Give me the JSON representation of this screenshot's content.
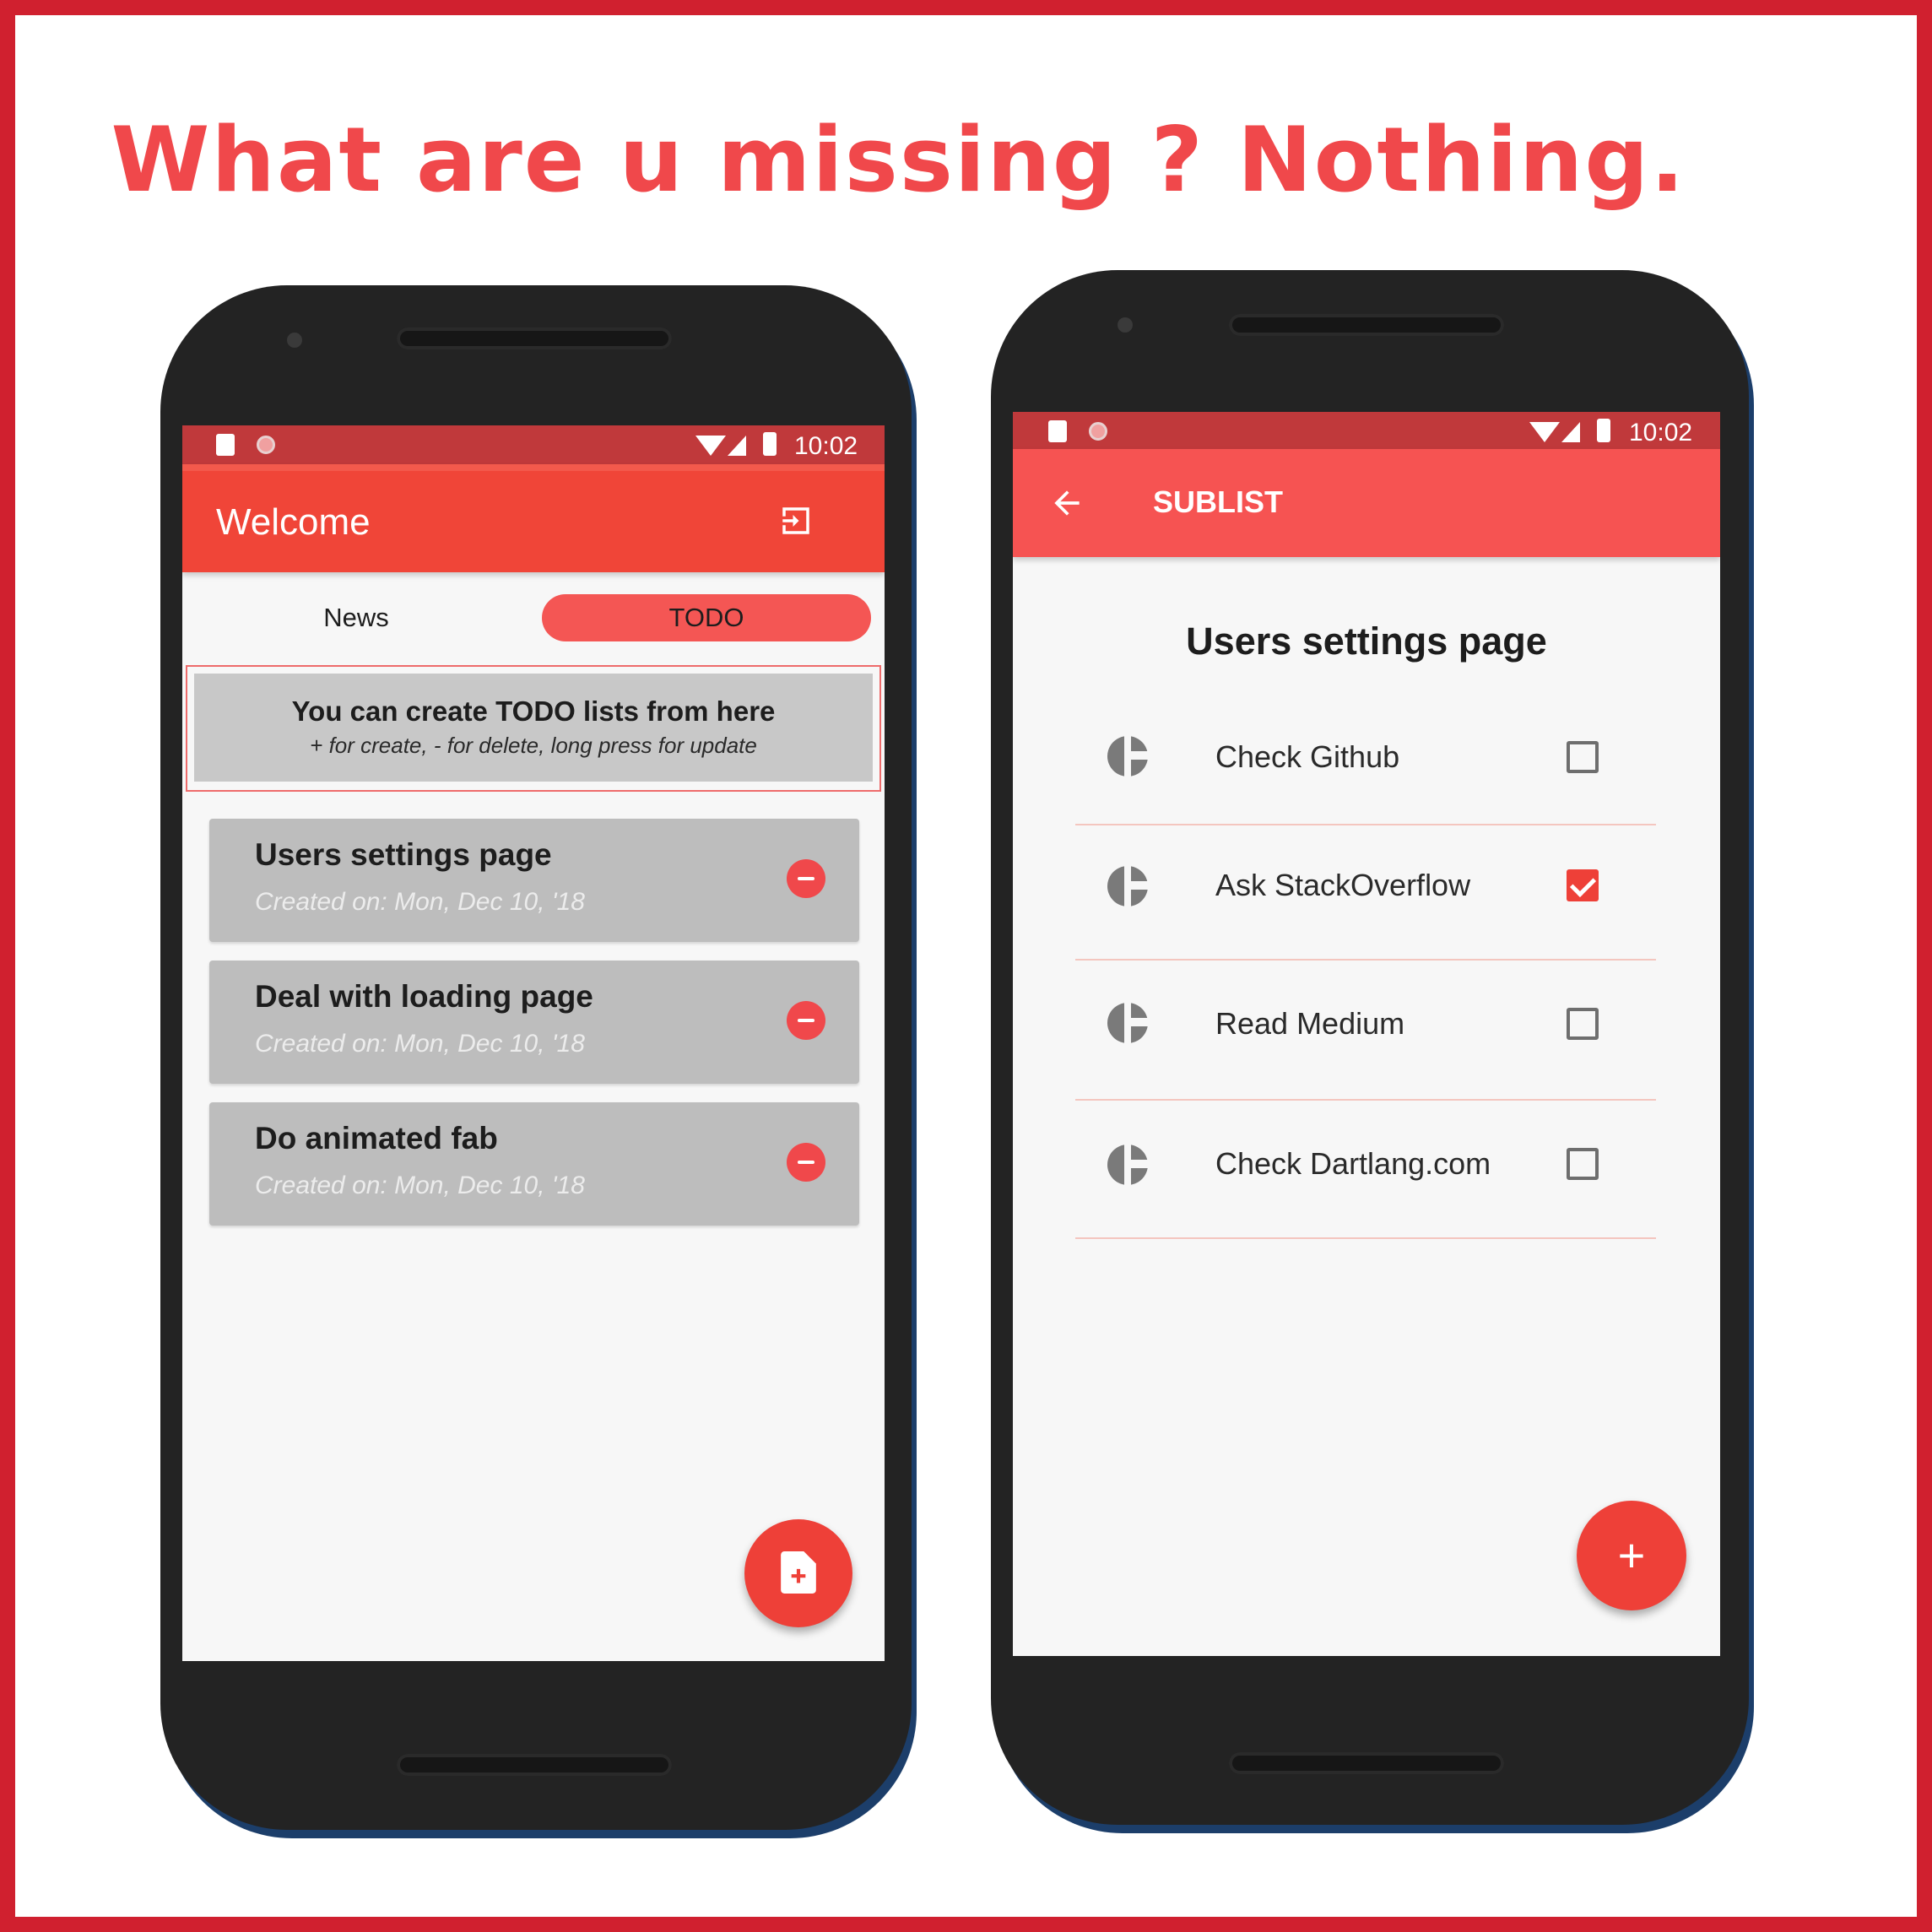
{
  "headline": "What are u missing ? Nothing.",
  "colors": {
    "brand_red": "#f0484b",
    "frame_red": "#d0202f",
    "status_bar": "#c0393b"
  },
  "left_phone": {
    "status_bar": {
      "time": "10:02",
      "icons": [
        "sd-card-icon",
        "circle-notification-icon",
        "wifi-icon",
        "signal-icon",
        "battery-icon"
      ]
    },
    "app_bar": {
      "title": "Welcome",
      "action_icon": "logout-icon"
    },
    "tabs": [
      {
        "label": "News",
        "selected": false
      },
      {
        "label": "TODO",
        "selected": true
      }
    ],
    "info_box": {
      "title": "You can create TODO lists from here",
      "subtitle": "+ for create, - for delete, long press for update"
    },
    "todo_lists": [
      {
        "title": "Users settings page",
        "created": "Created on: Mon, Dec 10, '18"
      },
      {
        "title": "Deal with loading page",
        "created": "Created on: Mon, Dec 10, '18"
      },
      {
        "title": "Do animated fab",
        "created": "Created on: Mon, Dec 10, '18"
      }
    ],
    "fab_icon": "new-document-icon"
  },
  "right_phone": {
    "status_bar": {
      "time": "10:02",
      "icons": [
        "sd-card-icon",
        "circle-notification-icon",
        "wifi-icon",
        "signal-icon",
        "battery-icon"
      ]
    },
    "app_bar": {
      "title": "SUBLIST",
      "nav_icon": "back-arrow-icon"
    },
    "list_title": "Users settings page",
    "items": [
      {
        "label": "Check Github",
        "checked": false
      },
      {
        "label": "Ask StackOverflow",
        "checked": true
      },
      {
        "label": "Read Medium",
        "checked": false
      },
      {
        "label": "Check Dartlang.com",
        "checked": false
      }
    ],
    "fab_label": "+"
  }
}
